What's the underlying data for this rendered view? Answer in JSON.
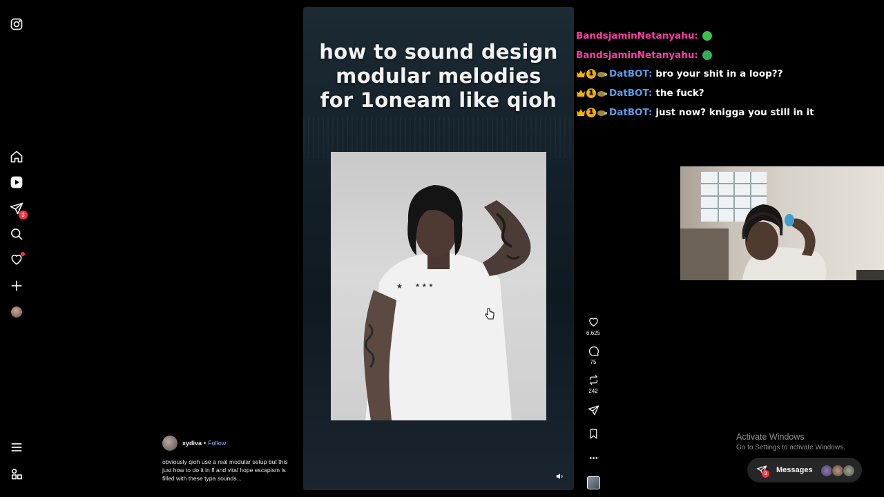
{
  "sidebar": {
    "items": [
      {
        "name": "instagram-logo",
        "icon": "instagram-icon"
      },
      {
        "name": "home",
        "icon": "home-icon"
      },
      {
        "name": "reels",
        "icon": "reels-icon"
      },
      {
        "name": "messages",
        "icon": "send-icon",
        "badge": "3"
      },
      {
        "name": "search",
        "icon": "search-icon"
      },
      {
        "name": "notifications",
        "icon": "heart-icon"
      },
      {
        "name": "create",
        "icon": "plus-icon"
      },
      {
        "name": "profile",
        "icon": "avatar"
      },
      {
        "name": "more",
        "icon": "menu-icon"
      },
      {
        "name": "also-from-meta",
        "icon": "grid-icon"
      }
    ],
    "messages_badge": "3"
  },
  "reel": {
    "overlay_title_lines": [
      "how to sound design",
      "modular melodies",
      "for 1oneam like qioh"
    ],
    "author": "xydiva",
    "separator": "•",
    "follow_label": "Follow",
    "caption": "obviously qioh use a real modular setup but this just how to do it in fl and vital hope escapism is filled with these typa sounds..."
  },
  "actions": {
    "like_count": "6,625",
    "comment_count": "75",
    "repost_count": "242"
  },
  "chat": [
    {
      "user": "BandsjaminNetanyahu:",
      "msg": "",
      "color": "#ff3da6",
      "badges": false,
      "emote": "#3bbf4a"
    },
    {
      "user": "BandsjaminNetanyahu:",
      "msg": "",
      "color": "#ff3da6",
      "badges": false,
      "emote": "#2fae5c"
    },
    {
      "user": "DatBOT:",
      "msg": "bro your shit in a loop??",
      "color": "#5d9be6",
      "badges": true
    },
    {
      "user": "DatBOT:",
      "msg": "the fuck?",
      "color": "#5d9be6",
      "badges": true
    },
    {
      "user": "DatBOT:",
      "msg": "just now? knigga you still in it",
      "color": "#5d9be6",
      "badges": true
    }
  ],
  "chat_badge_number": "1",
  "windows": {
    "activate_title": "Activate Windows",
    "activate_sub": "Go to Settings to activate Windows."
  },
  "messages_pill": {
    "label": "Messages",
    "badge": "3"
  },
  "colors": {
    "background": "#000000",
    "accent_red": "#ff3040",
    "link_blue": "#8fb1ff"
  }
}
